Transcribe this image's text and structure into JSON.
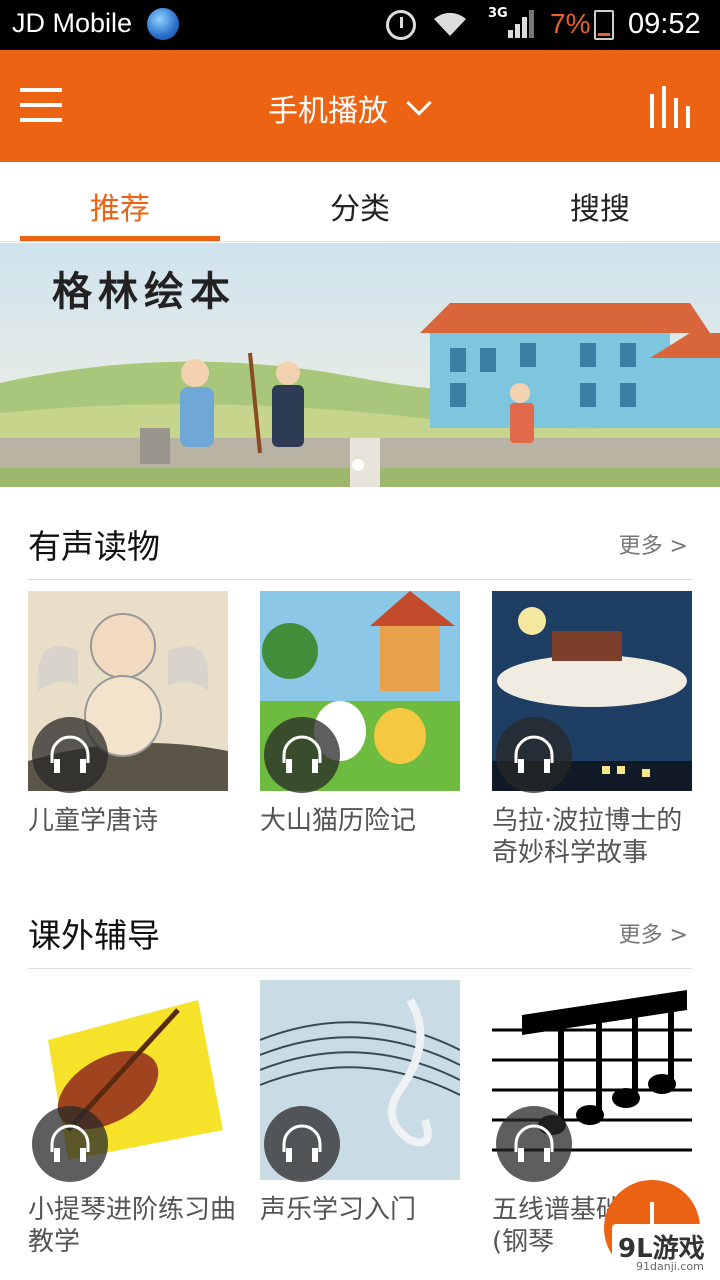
{
  "status_bar": {
    "carrier": "JD Mobile",
    "network": "3G",
    "battery": "7%",
    "time": "09:52"
  },
  "app_bar": {
    "title": "手机播放"
  },
  "tabs": [
    {
      "label": "推荐",
      "active": true
    },
    {
      "label": "分类",
      "active": false
    },
    {
      "label": "搜搜",
      "active": false
    }
  ],
  "banner": {
    "title": "格林绘本"
  },
  "sections": [
    {
      "title": "有声读物",
      "more": "更多 >",
      "items": [
        {
          "name": "儿童学唐诗"
        },
        {
          "name": "大山猫历险记"
        },
        {
          "name": "乌拉·波拉博士的奇妙科学故事"
        }
      ]
    },
    {
      "title": "课外辅导",
      "more": "更多 >",
      "items": [
        {
          "name": "小提琴进阶练习曲教学"
        },
        {
          "name": "声乐学习入门"
        },
        {
          "name": "五线谱基础教程(钢琴"
        }
      ]
    }
  ],
  "watermark": {
    "brand": "9L游戏",
    "site": "91danji.com"
  },
  "colors": {
    "accent": "#ec6313",
    "status_bar": "#000000"
  }
}
